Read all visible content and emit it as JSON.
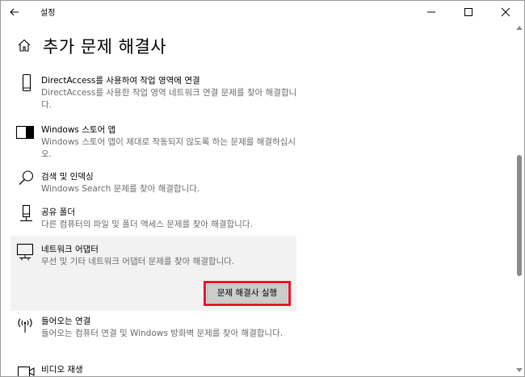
{
  "titlebar": {
    "app_title": "설정"
  },
  "page": {
    "title": "추가 문제 해결사"
  },
  "items": [
    {
      "title": "DirectAccess를 사용하여 작업 영역에 연결",
      "desc": "DirectAccess를 사용한 작업 영역 네트워크 연결 문제를 찾아 해결합니다.",
      "icon": "phone-icon"
    },
    {
      "title": "Windows 스토어 앱",
      "desc": "Windows 스토어 앱이 제대로 작동되지 않도록 하는 문제를 해결하십시오.",
      "icon": "store-app-icon"
    },
    {
      "title": "검색 및 인덱싱",
      "desc": "Windows Search 문제를 찾아 해결합니다.",
      "icon": "search-icon"
    },
    {
      "title": "공유 폴더",
      "desc": "다른 컴퓨터의 파일 및 폴더 액세스 문제를 찾아 해결합니다.",
      "icon": "shared-folder-icon"
    },
    {
      "title": "네트워크 어댑터",
      "desc": "무선 및 기타 네트워크 어댑터 문제를 찾아 해결합니다.",
      "icon": "network-adapter-icon",
      "button": "문제 해결사 실행"
    },
    {
      "title": "들어오는 연결",
      "desc": "들어오는 컴퓨터 연결 및 Windows 방화벽 문제를 찾아 해결합니다.",
      "icon": "incoming-connection-icon"
    },
    {
      "title": "비디오 재생",
      "desc": "",
      "icon": "video-icon"
    }
  ],
  "colors": {
    "highlight": "#e8132a",
    "button_bg": "#cccccc",
    "selected_bg": "#f2f2f2"
  }
}
